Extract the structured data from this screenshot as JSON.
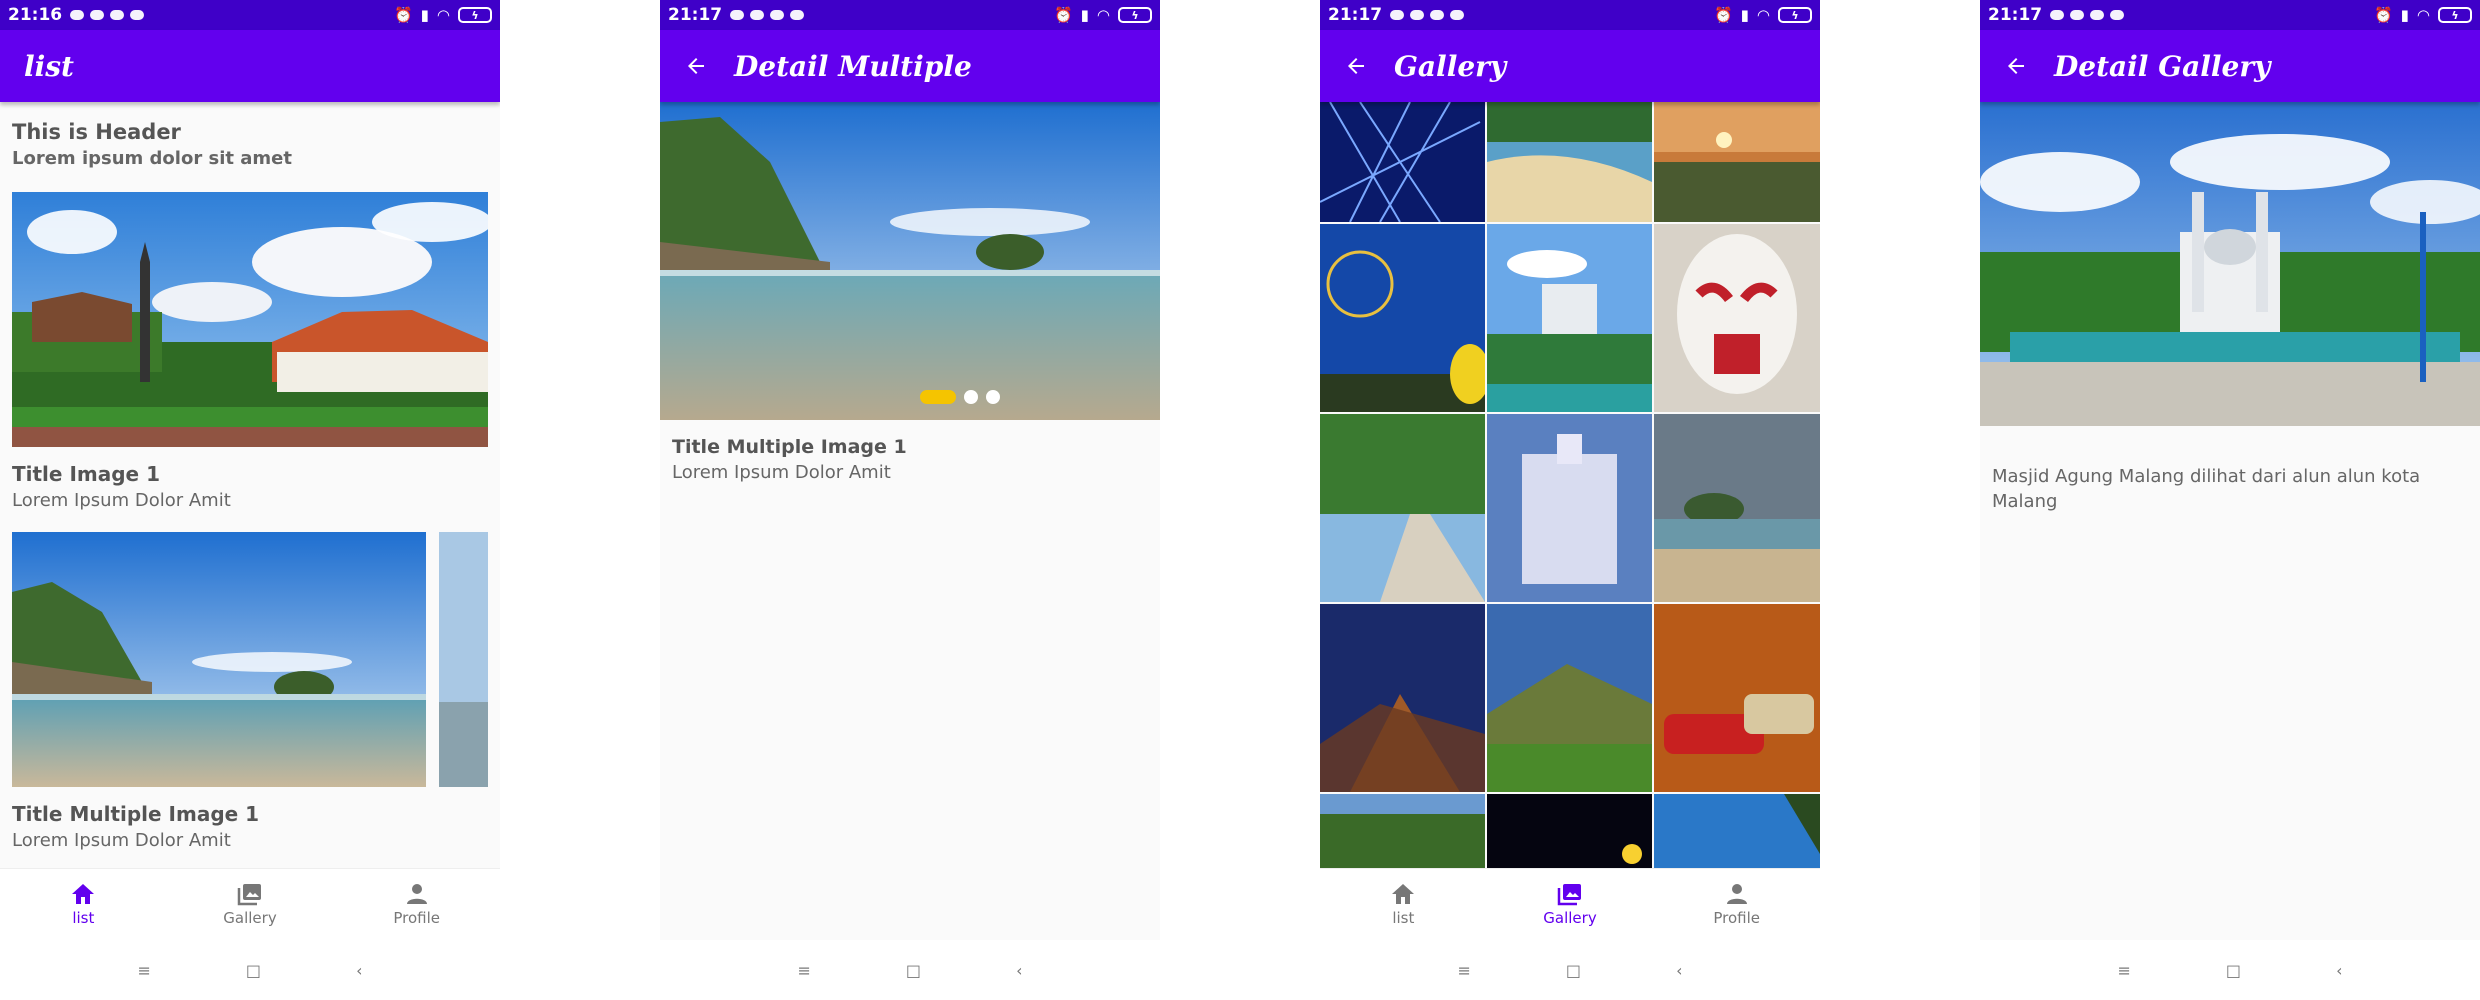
{
  "colors": {
    "status_bar": "#3f00c8",
    "app_bar": "#6200ee",
    "accent": "#6200ee",
    "indicator_active": "#f5c400"
  },
  "status_times": [
    "21:16",
    "21:17",
    "21:17",
    "21:17"
  ],
  "battery_label": "ϟ",
  "screens": {
    "list": {
      "app_title": "list",
      "header_title": "This is Header",
      "header_subtitle": "Lorem ipsum dolor sit amet",
      "card1_title": "Title Image 1",
      "card1_subtitle": "Lorem Ipsum Dolor Amit",
      "card2_title": "Title Multiple Image 1",
      "card2_subtitle": "Lorem Ipsum Dolor Amit"
    },
    "detail_multiple": {
      "app_title": "Detail Multiple",
      "title": "Title Multiple Image 1",
      "subtitle": "Lorem Ipsum Dolor Amit",
      "page_count": 3,
      "active_page": 1
    },
    "gallery": {
      "app_title": "Gallery"
    },
    "detail_gallery": {
      "app_title": "Detail Gallery",
      "description": "Masjid Agung Malang dilihat dari alun alun kota Malang"
    }
  },
  "bottom_nav": {
    "list_label": "list",
    "gallery_label": "Gallery",
    "profile_label": "Profile"
  },
  "icons": {
    "home": "home-icon",
    "gallery": "photo-library-icon",
    "profile": "person-icon",
    "back": "arrow-back-icon"
  }
}
